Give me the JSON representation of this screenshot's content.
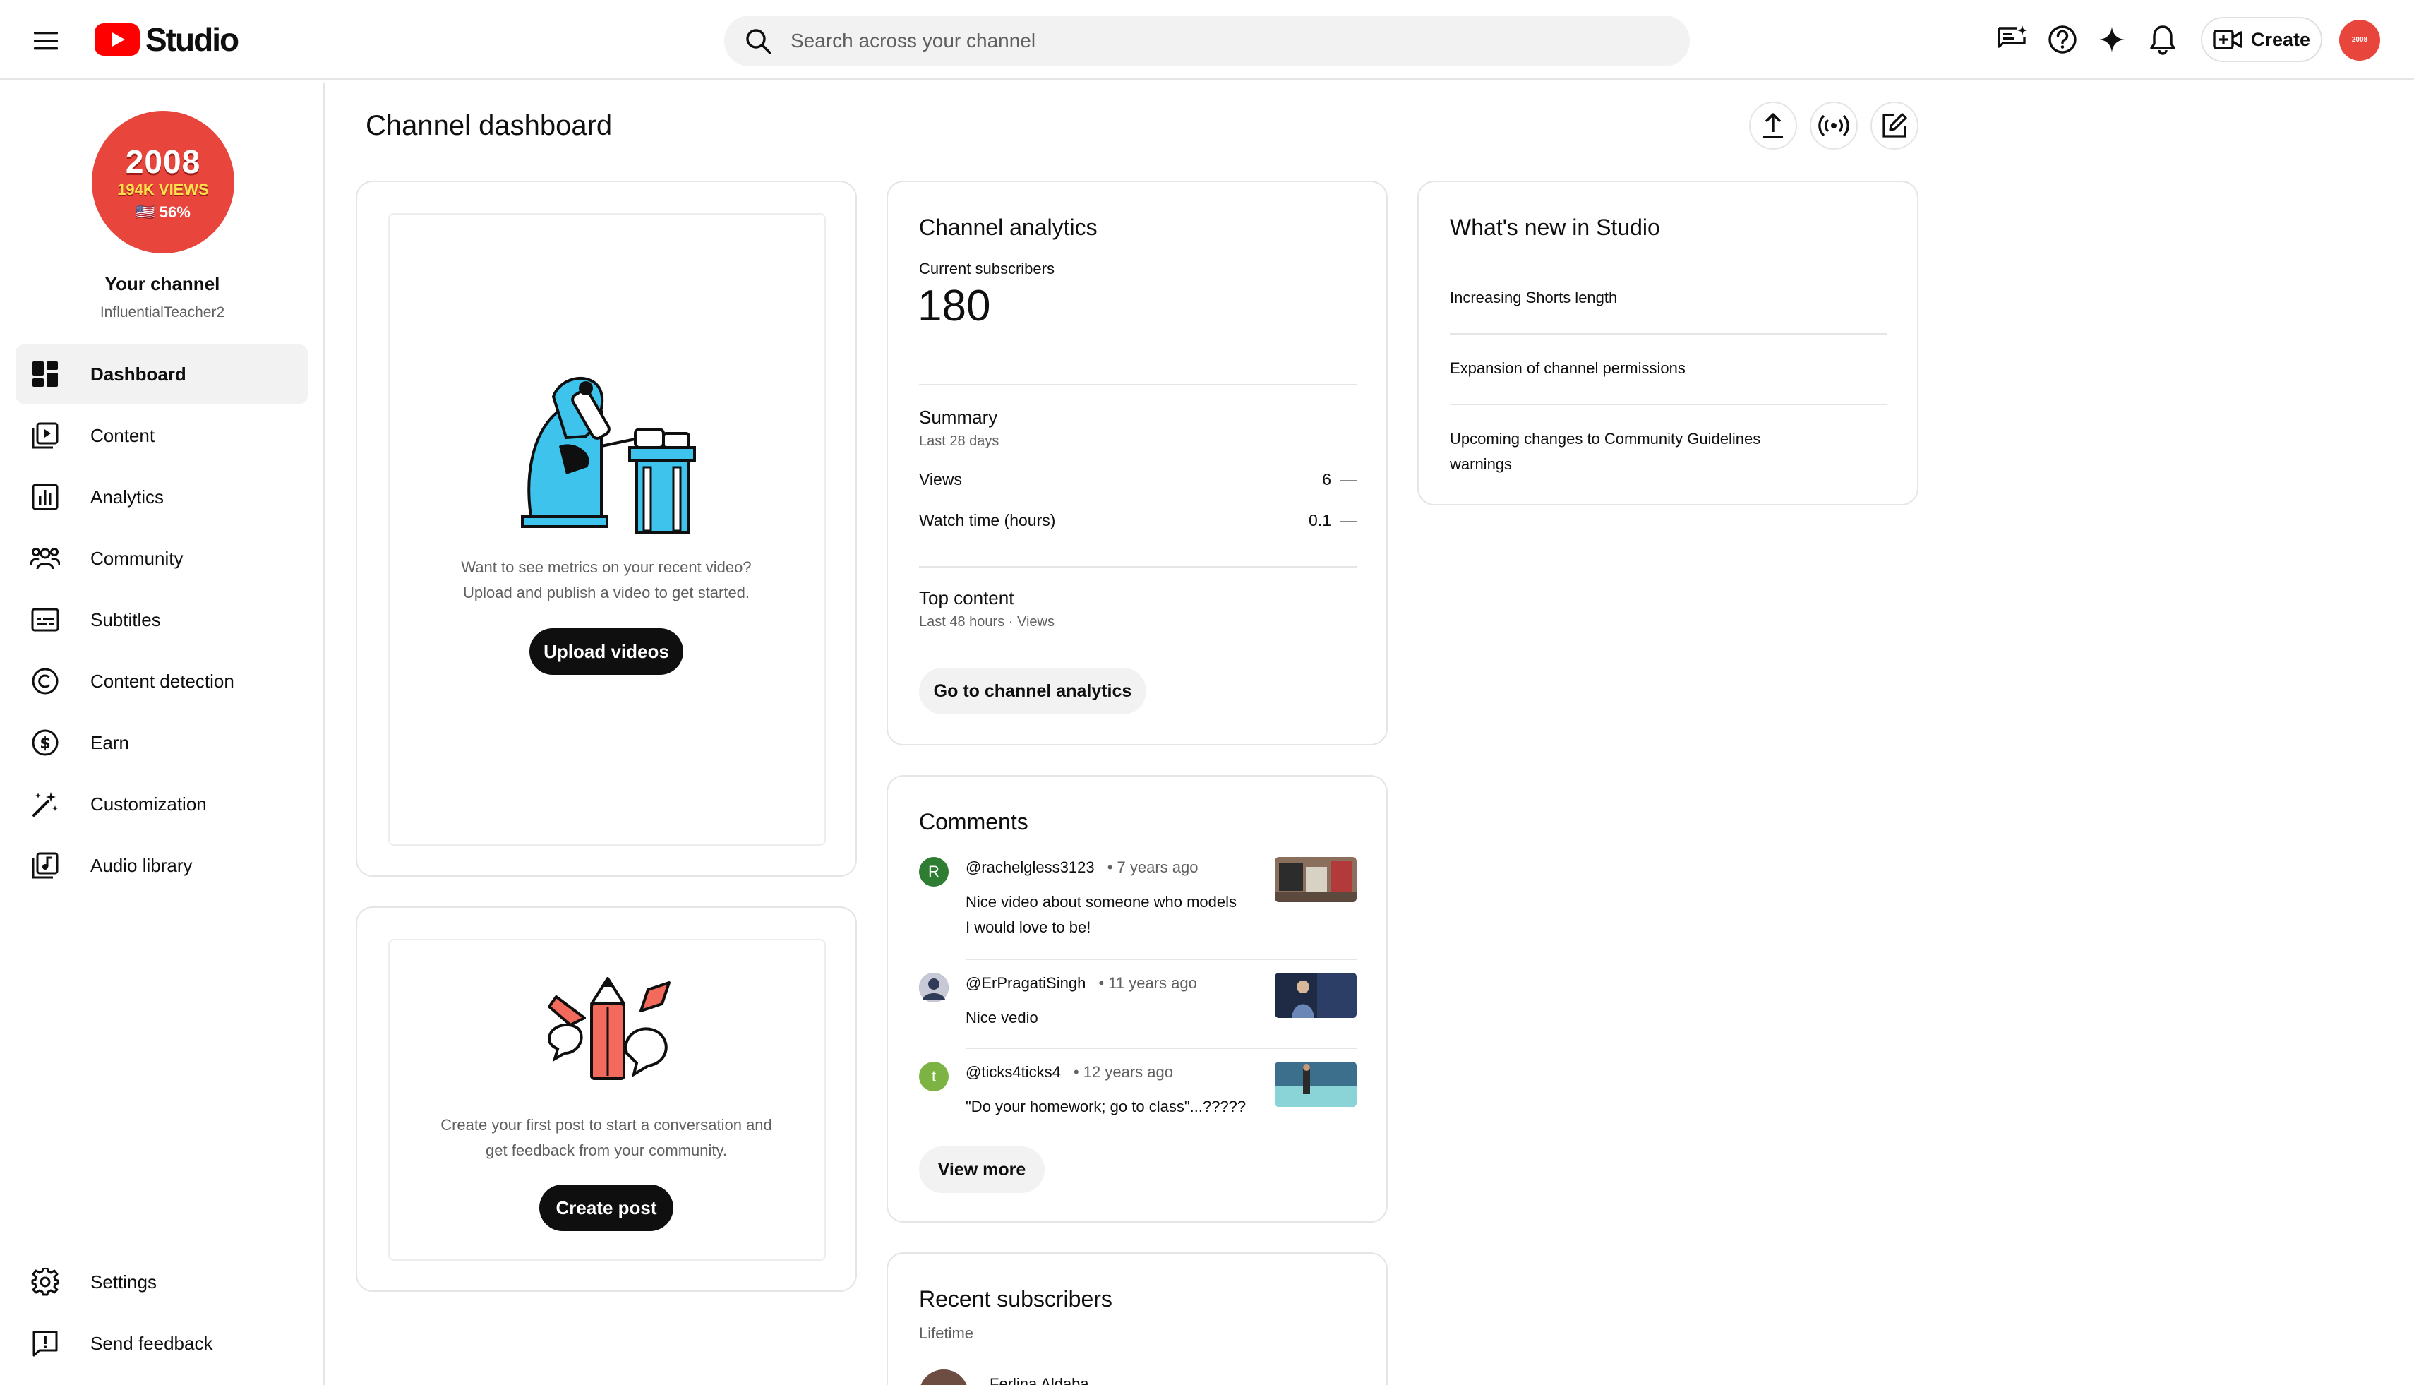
{
  "header": {
    "logo_text": "Studio",
    "search_placeholder": "Search across your channel",
    "create_label": "Create",
    "avatar_text": "2008"
  },
  "sidebar": {
    "avatar": {
      "year": "2008",
      "views": "194K VIEWS",
      "pct": "🇺🇸 56%"
    },
    "channel_label": "Your channel",
    "channel_handle": "InfluentialTeacher2",
    "items": [
      {
        "label": "Dashboard",
        "icon": "dashboard-icon",
        "active": true
      },
      {
        "label": "Content",
        "icon": "content-icon"
      },
      {
        "label": "Analytics",
        "icon": "analytics-icon"
      },
      {
        "label": "Community",
        "icon": "community-icon"
      },
      {
        "label": "Subtitles",
        "icon": "subtitles-icon"
      },
      {
        "label": "Content detection",
        "icon": "copyright-icon"
      },
      {
        "label": "Earn",
        "icon": "dollar-icon"
      },
      {
        "label": "Customization",
        "icon": "magic-wand-icon"
      },
      {
        "label": "Audio library",
        "icon": "audio-library-icon"
      }
    ],
    "bottom_items": [
      {
        "label": "Settings",
        "icon": "gear-icon"
      },
      {
        "label": "Send feedback",
        "icon": "feedback-icon"
      }
    ]
  },
  "main": {
    "title": "Channel dashboard",
    "upload_card": {
      "text_line1": "Want to see metrics on your recent video?",
      "text_line2": "Upload and publish a video to get started.",
      "button": "Upload videos"
    },
    "post_card": {
      "text_line1": "Create your first post to start a conversation and",
      "text_line2": "get feedback from your community.",
      "button": "Create post"
    },
    "analytics": {
      "title": "Channel analytics",
      "subs_label": "Current subscribers",
      "subs_value": "180",
      "summary_title": "Summary",
      "summary_period": "Last 28 days",
      "rows": [
        {
          "label": "Views",
          "value": "6",
          "trend": "—"
        },
        {
          "label": "Watch time (hours)",
          "value": "0.1",
          "trend": "—"
        }
      ],
      "top_content_title": "Top content",
      "top_content_period": "Last 48 hours · Views",
      "button": "Go to channel analytics"
    },
    "comments": {
      "title": "Comments",
      "items": [
        {
          "author": "@rachelgless3123",
          "time": "• 7 years ago",
          "text_line1": "Nice video about someone who models",
          "text_line2": "I would love to be!",
          "initial": "R",
          "color": "#2e7d32"
        },
        {
          "author": "@ErPragatiSingh",
          "time": "• 11 years ago",
          "text_line1": "Nice vedio",
          "text_line2": "",
          "initial": "",
          "color": "#3b4a6b"
        },
        {
          "author": "@ticks4ticks4",
          "time": "• 12 years ago",
          "text_line1": "\"Do your homework; go to class\"...?????",
          "text_line2": "",
          "initial": "t",
          "color": "#7cb342"
        }
      ],
      "button": "View more"
    },
    "recent_subscribers": {
      "title": "Recent subscribers",
      "period": "Lifetime",
      "first_name": "Ferlina Aldaba"
    },
    "whats_new": {
      "title": "What's new in Studio",
      "items": [
        {
          "line1": "Increasing Shorts length",
          "line2": ""
        },
        {
          "line1": "Expansion of channel permissions",
          "line2": ""
        },
        {
          "line1": "Upcoming changes to Community Guidelines",
          "line2": "warnings"
        }
      ]
    }
  },
  "colors": {
    "brand_red": "#ff0000",
    "avatar_red": "#e8453c",
    "text": "#0f0f0f",
    "muted": "#606060"
  }
}
